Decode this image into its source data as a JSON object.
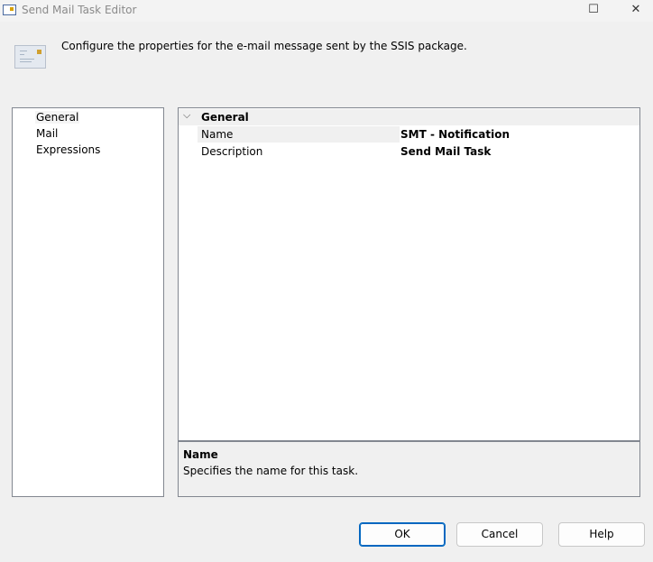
{
  "window": {
    "title": "Send Mail Task Editor"
  },
  "header": {
    "text": "Configure the properties for the e-mail message sent by the SSIS package."
  },
  "nav": {
    "items": [
      {
        "label": "General"
      },
      {
        "label": "Mail"
      },
      {
        "label": "Expressions"
      }
    ],
    "selected": "General"
  },
  "grid": {
    "category": "General",
    "rows": [
      {
        "name": "Name",
        "value": "SMT - Notification"
      },
      {
        "name": "Description",
        "value": "Send Mail Task"
      }
    ]
  },
  "description": {
    "title": "Name",
    "text": "Specifies the name for this task."
  },
  "buttons": {
    "ok": "OK",
    "cancel": "Cancel",
    "help": "Help"
  }
}
